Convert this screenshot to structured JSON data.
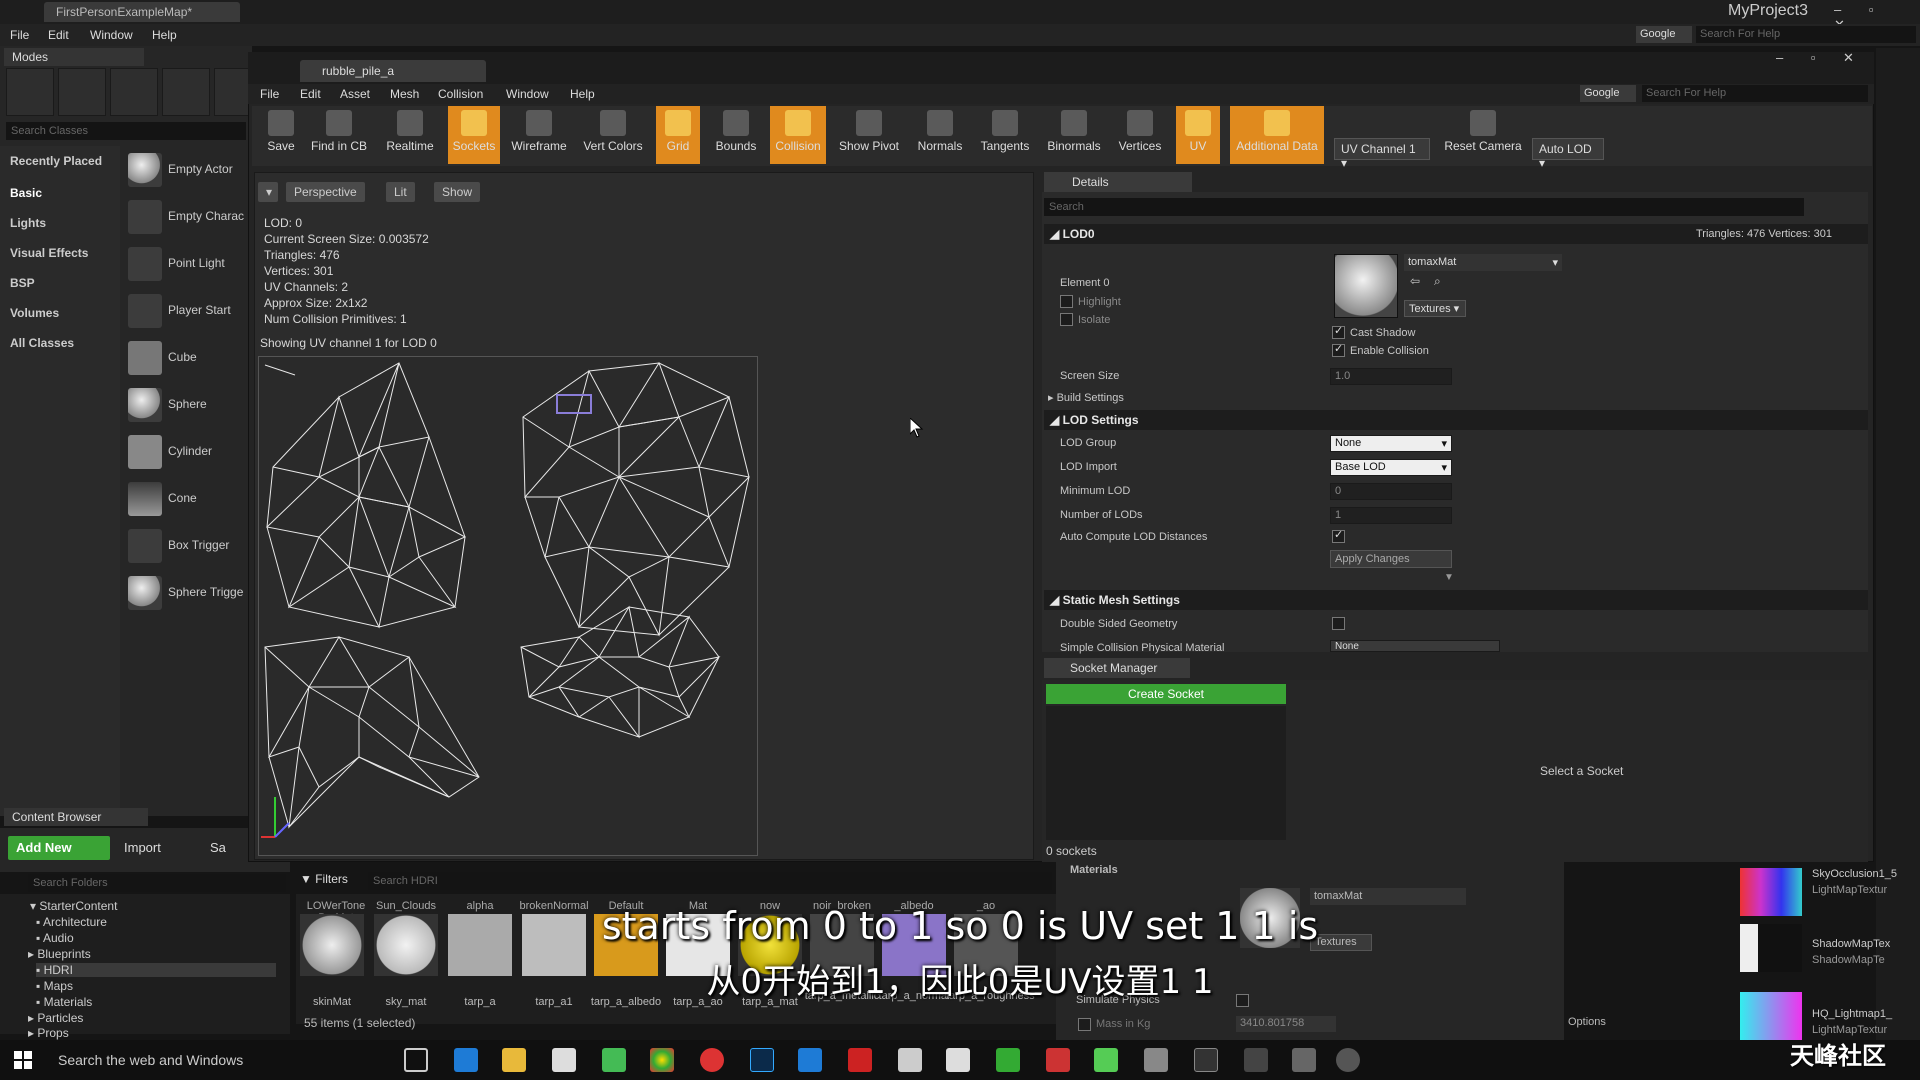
{
  "outer": {
    "map_tab": "FirstPersonExampleMap*",
    "menu": [
      "File",
      "Edit",
      "Window",
      "Help"
    ],
    "project": "MyProject3",
    "google": "Google",
    "help_search_placeholder": "Search For Help"
  },
  "modes": {
    "tab_label": "Modes",
    "search_placeholder": "Search Classes",
    "categories": [
      "Recently Placed",
      "Basic",
      "Lights",
      "Visual Effects",
      "BSP",
      "Volumes",
      "All Classes"
    ],
    "items": [
      "Empty Actor",
      "Empty Charac",
      "Point Light",
      "Player Start",
      "Cube",
      "Sphere",
      "Cylinder",
      "Cone",
      "Box Trigger",
      "Sphere Trigge"
    ]
  },
  "content_browser": {
    "tab_label": "Content Browser",
    "add_new": "Add New",
    "import": "Import",
    "save": "Sa",
    "folder_search_placeholder": "Search Folders",
    "folders": [
      "StarterContent",
      "Architecture",
      "Audio",
      "Blueprints",
      "HDRI",
      "Maps",
      "Materials",
      "Particles",
      "Props"
    ],
    "filters": "Filters",
    "asset_search_placeholder": "Search HDRI",
    "assets_top": [
      "LOWerTone BarMat",
      "Sun_Clouds",
      "alpha",
      "brokenNormal",
      "Default",
      "Mat",
      "now",
      "noir_broken",
      "_albedo",
      "_ao",
      "",
      ""
    ],
    "assets": [
      "skinMat",
      "sky_mat",
      "tarp_a",
      "tarp_a1",
      "tarp_a_albedo",
      "tarp_a_ao",
      "tarp_a_mat",
      "tarp_a_metallic",
      "tarp_a_normal",
      "tarp_a_roughness"
    ],
    "items_count": "55 items (1 selected)"
  },
  "mesh_editor": {
    "tab_label": "rubble_pile_a",
    "menu": [
      "File",
      "Edit",
      "Asset",
      "Mesh",
      "Collision",
      "Window",
      "Help"
    ],
    "google": "Google",
    "help_search_placeholder": "Search For Help",
    "toolbar": [
      {
        "label": "Save",
        "on": false
      },
      {
        "label": "Find in CB",
        "on": false
      },
      {
        "label": "Realtime",
        "on": false
      },
      {
        "label": "Sockets",
        "on": true
      },
      {
        "label": "Wireframe",
        "on": false
      },
      {
        "label": "Vert Colors",
        "on": false
      },
      {
        "label": "Grid",
        "on": true
      },
      {
        "label": "Bounds",
        "on": false
      },
      {
        "label": "Collision",
        "on": true
      },
      {
        "label": "Show Pivot",
        "on": false
      },
      {
        "label": "Normals",
        "on": false
      },
      {
        "label": "Tangents",
        "on": false
      },
      {
        "label": "Binormals",
        "on": false
      },
      {
        "label": "Vertices",
        "on": false
      },
      {
        "label": "UV",
        "on": true
      },
      {
        "label": "Additional Data",
        "on": true
      }
    ],
    "uv_channel": "UV Channel 1",
    "reset_camera": "Reset Camera",
    "auto_lod": "Auto LOD"
  },
  "viewport": {
    "perspective": "Perspective",
    "lit": "Lit",
    "show": "Show",
    "stats": [
      "LOD:  0",
      "Current Screen Size:  0.003572",
      "Triangles:  476",
      "Vertices:  301",
      "UV Channels:  2",
      "Approx Size: 2x1x2",
      "Num Collision Primitives:  1"
    ],
    "caption": "Showing UV channel 1 for LOD 0"
  },
  "details": {
    "tab_label": "Details",
    "search_placeholder": "Search",
    "lod0_header": "LOD0",
    "tri_info": "Triangles: 476    Vertices: 301",
    "element": "Element 0",
    "highlight": "Highlight",
    "isolate": "Isolate",
    "material": "tomaxMat",
    "textures": "Textures",
    "cast_shadow": "Cast Shadow",
    "enable_collision": "Enable Collision",
    "screen_size_label": "Screen Size",
    "screen_size_value": "1.0",
    "build_settings": "Build Settings",
    "lod_settings_header": "LOD Settings",
    "lod_group_label": "LOD Group",
    "lod_group_value": "None",
    "lod_import_label": "LOD Import",
    "lod_import_value": "Base LOD",
    "min_lod_label": "Minimum LOD",
    "min_lod_value": "0",
    "num_lods_label": "Number of LODs",
    "num_lods_value": "1",
    "auto_compute_label": "Auto Compute LOD Distances",
    "apply_changes": "Apply Changes",
    "static_mesh_header": "Static Mesh Settings",
    "double_sided_label": "Double Sided Geometry",
    "simple_collision_label": "Simple Collision Physical Material",
    "simple_collision_value": "None"
  },
  "socket_manager": {
    "tab_label": "Socket Manager",
    "create_socket": "Create Socket",
    "socket_count": "0 sockets",
    "select_socket": "Select a Socket"
  },
  "bg_details": {
    "materials": "Materials",
    "material": "tomaxMat",
    "textures": "Textures",
    "simulate_physics": "Simulate Physics",
    "mass_label": "Mass in Kg",
    "mass_value": "3410.801758",
    "options": "Options"
  },
  "lightmaps": [
    {
      "name": "SkyOcclusion1_5",
      "type": "LightMapTextur"
    },
    {
      "name": "ShadowMapTex",
      "type": "ShadowMapTe"
    },
    {
      "name": "HQ_Lightmap1_",
      "type": "LightMapTextur"
    }
  ],
  "taskbar": {
    "search": "Search the web and Windows"
  },
  "subtitles": {
    "en": "starts from 0 to 1 so 0 is UV set 1 1 is",
    "zh": "从0开始到1，因此0是UV设置1 1"
  },
  "watermark": "天峰社区"
}
